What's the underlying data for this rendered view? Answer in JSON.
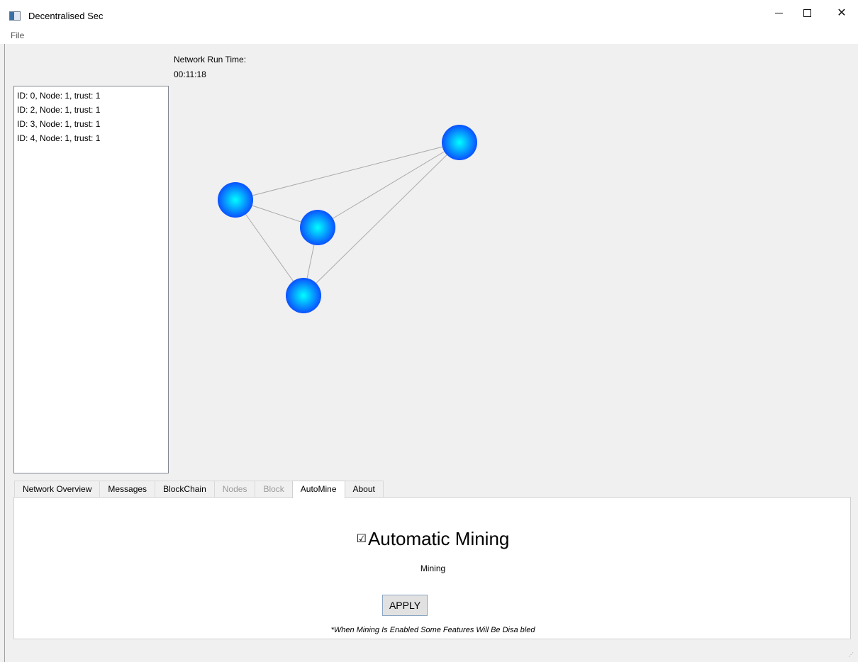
{
  "window": {
    "title": "Decentralised Sec",
    "controls": {
      "minimize": "minimize-icon",
      "maximize": "maximize-icon",
      "close": "close-icon"
    }
  },
  "menu": {
    "file": "File"
  },
  "network": {
    "run_time_label": "Network Run Time:",
    "run_time_value": "00:11:18"
  },
  "node_list": [
    "ID: 0, Node: 1, trust: 1",
    "ID: 2, Node: 1, trust: 1",
    "ID: 3, Node: 1, trust: 1",
    "ID: 4, Node: 1, trust: 1"
  ],
  "graph": {
    "node_color": "#0a5cff",
    "node_highlight": "#00ffff",
    "edge_color": "#aaaaaa",
    "edges": [
      [
        "n1",
        "n2"
      ],
      [
        "n1",
        "n3"
      ],
      [
        "n1",
        "n4"
      ],
      [
        "n2",
        "n3"
      ],
      [
        "n2",
        "n4"
      ],
      [
        "n3",
        "n4"
      ]
    ]
  },
  "tabs": [
    {
      "label": "Network Overview",
      "state": "normal"
    },
    {
      "label": "Messages",
      "state": "normal"
    },
    {
      "label": "BlockChain",
      "state": "normal"
    },
    {
      "label": "Nodes",
      "state": "disabled"
    },
    {
      "label": "Block",
      "state": "disabled"
    },
    {
      "label": "AutoMine",
      "state": "active"
    },
    {
      "label": "About",
      "state": "normal"
    }
  ],
  "automine": {
    "checkbox_label": "Automatic Mining",
    "checked": true,
    "status": "Mining",
    "apply_label": "APPLY",
    "note": "*When Mining Is Enabled Some Features Will Be Disa bled"
  }
}
